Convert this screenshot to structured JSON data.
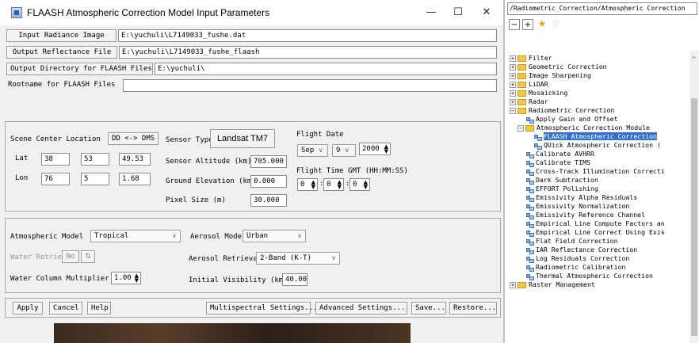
{
  "dialog": {
    "title": "FLAASH Atmospheric Correction Model Input Parameters",
    "window_controls": {
      "minimize": "—",
      "maximize": "☐",
      "close": "✕"
    }
  },
  "files": {
    "input_label": "Input Radiance Image",
    "input_value": "E:\\yuchuli\\L7149033_fushe.dat",
    "output_label": "Output Reflectance File",
    "output_value": "E:\\yuchuli\\L7149033_fushe_flaash",
    "outdir_label": "Output Directory for FLAASH Files",
    "outdir_value": "E:\\yuchuli\\",
    "rootname_label": "Rootname for FLAASH Files",
    "rootname_value": ""
  },
  "scene": {
    "center_label": "Scene Center Location",
    "dd_dms_button": "DD <-> DMS",
    "lat_label": "Lat",
    "lat": [
      "38",
      "53",
      "49.53"
    ],
    "lon_label": "Lon",
    "lon": [
      "76",
      "5",
      "1.68"
    ],
    "sensor_type_label": "Sensor Type",
    "sensor_type_value": "Landsat TM7",
    "sensor_altitude_label": "Sensor Altitude (km)",
    "sensor_altitude_value": "705.000",
    "ground_elev_label": "Ground Elevation (km)",
    "ground_elev_value": "0.000",
    "pixel_size_label": "Pixel Size (m)",
    "pixel_size_value": "30.000",
    "flight_date_label": "Flight Date",
    "month": "Sep",
    "day": "9",
    "year": "2000",
    "flight_time_label": "Flight Time GMT (HH:MM:SS)",
    "hh": "0",
    "mm": "0",
    "ss": "0"
  },
  "model": {
    "atm_model_label": "Atmospheric Model",
    "atm_model_value": "Tropical",
    "aerosol_model_label": "Aerosol Model",
    "aerosol_model_value": "Urban",
    "water_retrieval_label": "Water Retrieval",
    "water_retrieval_value": "No",
    "toggle_glyph": "⇅",
    "aerosol_retrieval_label": "Aerosol Retrieval",
    "aerosol_retrieval_value": "2-Band (K-T)",
    "water_col_label": "Water Column Multiplier",
    "water_col_value": "1.00",
    "visibility_label": "Initial Visibility (km)",
    "visibility_value": "40.00"
  },
  "buttons": {
    "apply": "Apply",
    "cancel": "Cancel",
    "help": "Help",
    "multispectral": "Multispectral Settings...",
    "advanced": "Advanced Settings...",
    "save": "Save...",
    "restore": "Restore..."
  },
  "tree": {
    "path": "/Radiometric Correction/Atmospheric Correction",
    "toolbar": {
      "collapse": "−",
      "expand": "+",
      "star": "★",
      "star_outline": "☆"
    },
    "items": [
      {
        "label": "Filter",
        "type": "folder",
        "level": 0,
        "exp": "+"
      },
      {
        "label": "Geometric Correction",
        "type": "folder",
        "level": 0,
        "exp": "+"
      },
      {
        "label": "Image Sharpening",
        "type": "folder",
        "level": 0,
        "exp": "+"
      },
      {
        "label": "LiDAR",
        "type": "folder",
        "level": 0,
        "exp": "+"
      },
      {
        "label": "Mosaicking",
        "type": "folder",
        "level": 0,
        "exp": "+"
      },
      {
        "label": "Radar",
        "type": "folder",
        "level": 0,
        "exp": "+"
      },
      {
        "label": "Radiometric Correction",
        "type": "folder",
        "level": 0,
        "exp": "−"
      },
      {
        "label": "Apply Gain and Offset",
        "type": "leaf",
        "level": 1
      },
      {
        "label": "Atmospheric Correction Module",
        "type": "folder",
        "level": 1,
        "exp": "−"
      },
      {
        "label": "FLAASH Atmospheric Correction",
        "type": "leaf",
        "level": 2,
        "selected": true
      },
      {
        "label": "QUick Atmospheric Correction (",
        "type": "leaf",
        "level": 2
      },
      {
        "label": "Calibrate AVHRR",
        "type": "leaf",
        "level": 1
      },
      {
        "label": "Calibrate TIMS",
        "type": "leaf",
        "level": 1
      },
      {
        "label": "Cross-Track Illumination Correcti",
        "type": "leaf",
        "level": 1
      },
      {
        "label": "Dark Subtraction",
        "type": "leaf",
        "level": 1
      },
      {
        "label": "EFFORT Polishing",
        "type": "leaf",
        "level": 1
      },
      {
        "label": "Emissivity Alpha Residuals",
        "type": "leaf",
        "level": 1
      },
      {
        "label": "Emissivity Normalization",
        "type": "leaf",
        "level": 1
      },
      {
        "label": "Emissivity Reference Channel",
        "type": "leaf",
        "level": 1
      },
      {
        "label": "Empirical Line Compute Factors an",
        "type": "leaf",
        "level": 1
      },
      {
        "label": "Empirical Line Correct Using Exis",
        "type": "leaf",
        "level": 1
      },
      {
        "label": "Flat Field Correction",
        "type": "leaf",
        "level": 1
      },
      {
        "label": "IAR Reflectance Correction",
        "type": "leaf",
        "level": 1
      },
      {
        "label": "Log Residuals Correction",
        "type": "leaf",
        "level": 1
      },
      {
        "label": "Radiometric Calibration",
        "type": "leaf",
        "level": 1
      },
      {
        "label": "Thermal Atmospheric Correction",
        "type": "leaf",
        "level": 1
      },
      {
        "label": "Raster Management",
        "type": "folder",
        "level": 0,
        "exp": "+"
      }
    ]
  },
  "colors": {
    "selection": "#3070d0",
    "folder": "#f1c64a"
  }
}
